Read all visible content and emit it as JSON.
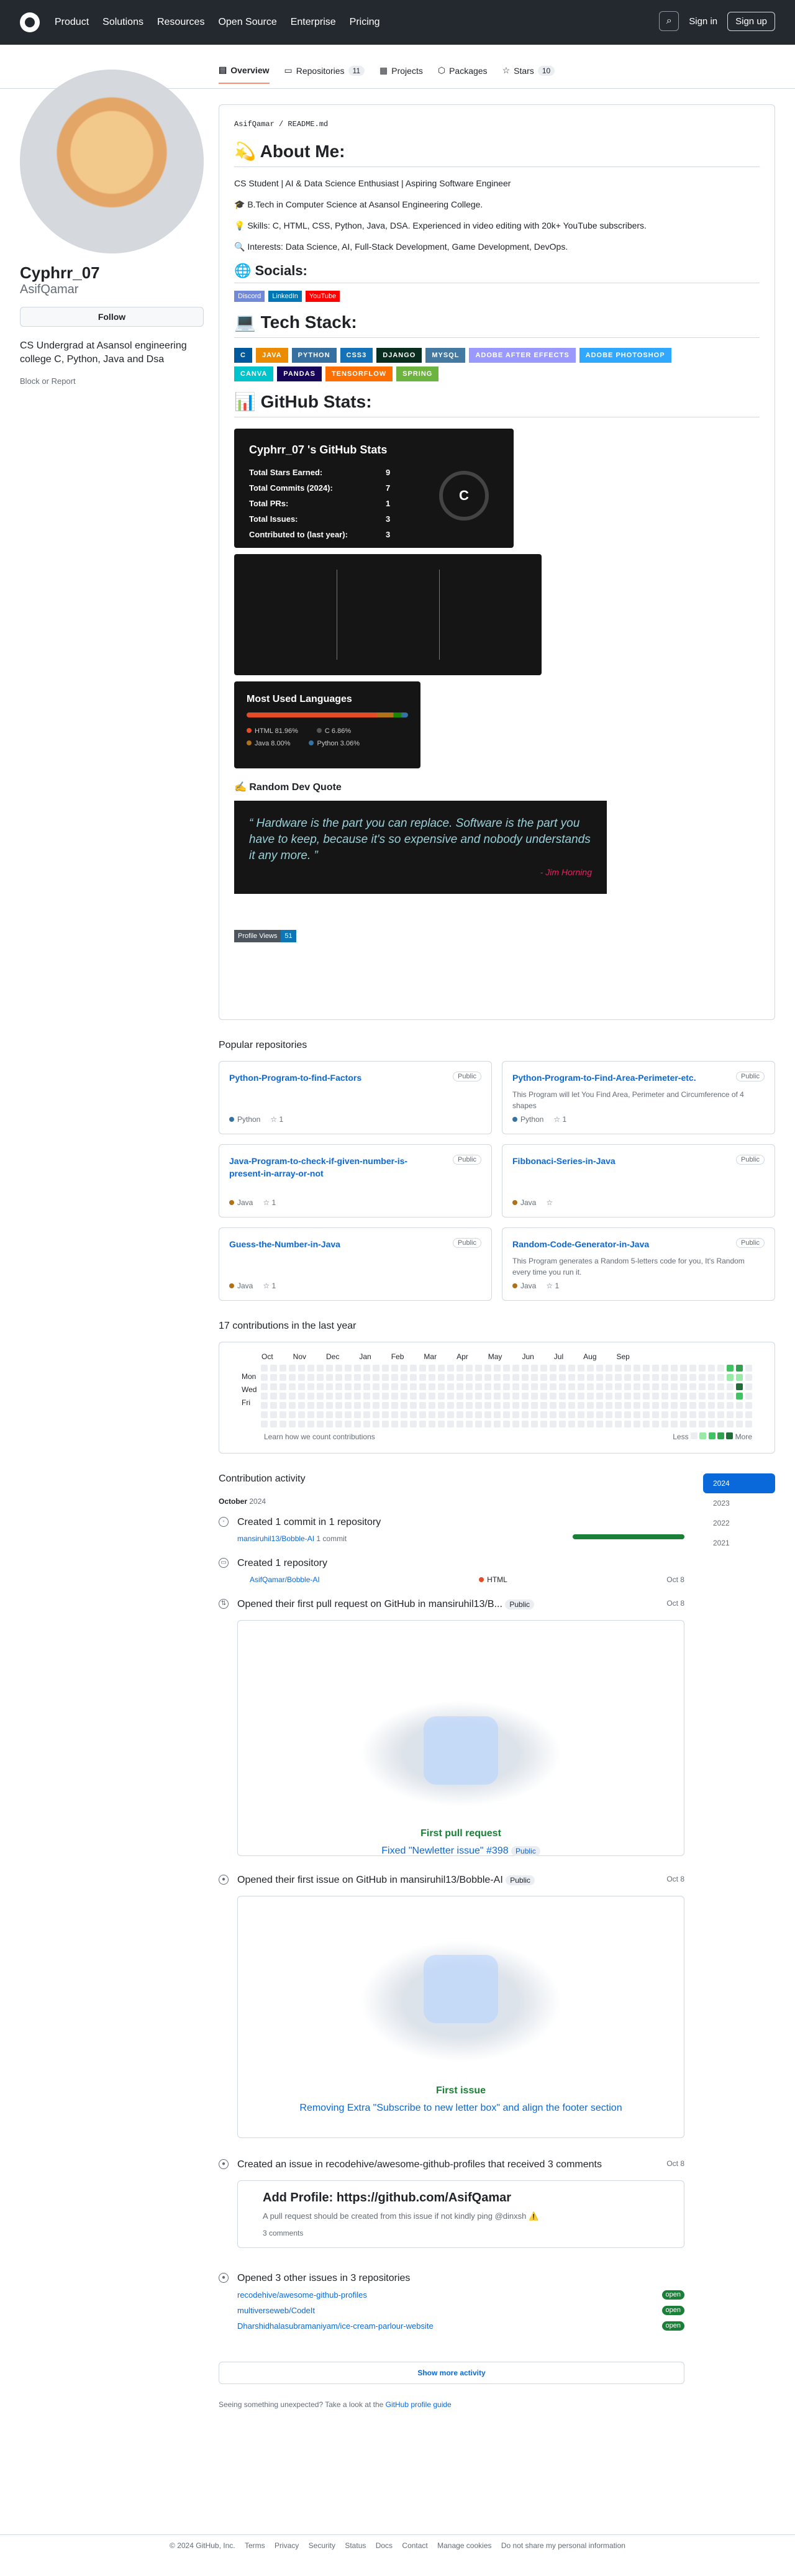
{
  "header": {
    "nav": [
      "Product",
      "Solutions",
      "Resources",
      "Open Source",
      "Enterprise",
      "Pricing"
    ],
    "signin": "Sign in",
    "signup": "Sign up"
  },
  "tabs": [
    {
      "label": "Overview"
    },
    {
      "label": "Repositories",
      "count": "11"
    },
    {
      "label": "Projects"
    },
    {
      "label": "Packages"
    },
    {
      "label": "Stars",
      "count": "10"
    }
  ],
  "profile": {
    "name": "Cyphrr_07",
    "login": "AsifQamar",
    "follow": "Follow",
    "bio": "CS Undergrad at Asansol engineering college C, Python, Java and Dsa",
    "block": "Block or Report"
  },
  "readme": {
    "path": "AsifQamar / README.md",
    "about": "💫 About Me:",
    "lines": [
      "CS Student | AI & Data Science Enthusiast | Aspiring Software Engineer",
      "🎓 B.Tech in Computer Science at Asansol Engineering College.",
      "💡 Skills: C, HTML, CSS, Python, Java, DSA. Experienced in video editing with 20k+ YouTube subscribers.",
      "🔍 Interests: Data Science, AI, Full-Stack Development, Game Development, DevOps."
    ],
    "socials": "🌐 Socials:",
    "social_badges": [
      "Discord",
      "LinkedIn",
      "YouTube"
    ],
    "tech": "💻 Tech Stack:",
    "tech_badges": [
      "C",
      "JAVA",
      "PYTHON",
      "CSS3",
      "DJANGO",
      "MYSQL",
      "ADOBE AFTER EFFECTS",
      "ADOBE PHOTOSHOP",
      "CANVA",
      "PANDAS",
      "TENSORFLOW",
      "SPRING"
    ],
    "stats_title": "📊 GitHub Stats:",
    "stats_card": "Cyphrr_07 's GitHub Stats",
    "stats": [
      {
        "k": "Total Stars Earned:",
        "v": "9"
      },
      {
        "k": "Total Commits (2024):",
        "v": "7"
      },
      {
        "k": "Total PRs:",
        "v": "1"
      },
      {
        "k": "Total Issues:",
        "v": "3"
      },
      {
        "k": "Contributed to (last year):",
        "v": "3"
      }
    ],
    "grade": "C",
    "lang_title": "Most Used Languages",
    "langs": [
      {
        "n": "HTML 81.96%",
        "c": "#e34c26"
      },
      {
        "n": "C 6.86%",
        "c": "#555555"
      },
      {
        "n": "Java 8.00%",
        "c": "#b07219"
      },
      {
        "n": "Python 3.06%",
        "c": "#3572a5"
      }
    ],
    "quote_title": "✍️ Random Dev Quote",
    "quote": "“ Hardware is the part you can replace. Software is the part you have to keep, because it's so expensive and nobody understands it any more. ”",
    "quote_author": "- Jim Horning",
    "views_label": "Profile Views",
    "views": "51"
  },
  "pinned_title": "Popular repositories",
  "pins": [
    {
      "name": "Python-Program-to-find-Factors",
      "desc": "",
      "lang": "Python",
      "lc": "#3572a5",
      "stars": "1"
    },
    {
      "name": "Python-Program-to-Find-Area-Perimeter-etc.",
      "desc": "This Program will let You Find Area, Perimeter and Circumference of 4 shapes",
      "lang": "Python",
      "lc": "#3572a5",
      "stars": "1"
    },
    {
      "name": "Java-Program-to-check-if-given-number-is-present-in-array-or-not",
      "desc": "",
      "lang": "Java",
      "lc": "#b07219",
      "stars": "1"
    },
    {
      "name": "Fibbonaci-Series-in-Java",
      "desc": "",
      "lang": "Java",
      "lc": "#b07219",
      "stars": ""
    },
    {
      "name": "Guess-the-Number-in-Java",
      "desc": "",
      "lang": "Java",
      "lc": "#b07219",
      "stars": "1"
    },
    {
      "name": "Random-Code-Generator-in-Java",
      "desc": "This Program generates a Random 5-letters code for you, It's Random every time you run it.",
      "lang": "Java",
      "lc": "#b07219",
      "stars": "1"
    }
  ],
  "pin_public": "Public",
  "contrib": {
    "title": "17 contributions in the last year",
    "months": [
      "Oct",
      "Nov",
      "Dec",
      "Jan",
      "Feb",
      "Mar",
      "Apr",
      "May",
      "Jun",
      "Jul",
      "Aug",
      "Sep"
    ],
    "days": [
      "Mon",
      "Wed",
      "Fri"
    ],
    "learn": "Learn how we count contributions",
    "less": "Less",
    "more": "More"
  },
  "activity": {
    "title": "Contribution activity",
    "years": [
      "2024",
      "2023",
      "2022",
      "2021"
    ],
    "month": "October",
    "year": "2024",
    "commit": {
      "text": "Created 1 commit in 1 repository",
      "repo": "mansiruhil13/Bobble-AI",
      "n": "1 commit"
    },
    "repo": {
      "text": "Created 1 repository",
      "name": "AsifQamar/Bobble-AI",
      "lang": "HTML",
      "date": "Oct 8"
    },
    "pr": {
      "text": "Opened their first pull request on GitHub in mansiruhil13/B...",
      "tag": "Public",
      "date": "Oct 8",
      "label": "First pull request",
      "link": "Fixed \"Newletter issue\" #398",
      "tag2": "Public"
    },
    "issue": {
      "text": "Opened their first issue on GitHub in mansiruhil13/Bobble-AI",
      "tag": "Public",
      "date": "Oct 8",
      "label": "First issue",
      "link": "Removing Extra \"Subscribe to new letter box\" and align the footer section"
    },
    "issue2": {
      "text": "Created an issue in recodehive/awesome-github-profiles that received 3 comments",
      "date": "Oct 8",
      "title": "Add Profile: https://github.com/AsifQamar",
      "body": "A pull request should be created from this issue if not kindly ping @dinxsh ⚠️",
      "comments": "3 comments"
    },
    "others": {
      "text": "Opened 3 other issues in 3 repositories",
      "repos": [
        "recodehive/awesome-github-profiles",
        "multiverseweb/CodeIt",
        "Dharshidhalasubramaniyam/ice-cream-parlour-website"
      ],
      "state": "open"
    },
    "more": "Show more activity",
    "hint": "Seeing something unexpected? Take a look at the",
    "hint_link": "GitHub profile guide"
  },
  "footer": [
    "© 2024 GitHub, Inc.",
    "Terms",
    "Privacy",
    "Security",
    "Status",
    "Docs",
    "Contact",
    "Manage cookies",
    "Do not share my personal information"
  ]
}
